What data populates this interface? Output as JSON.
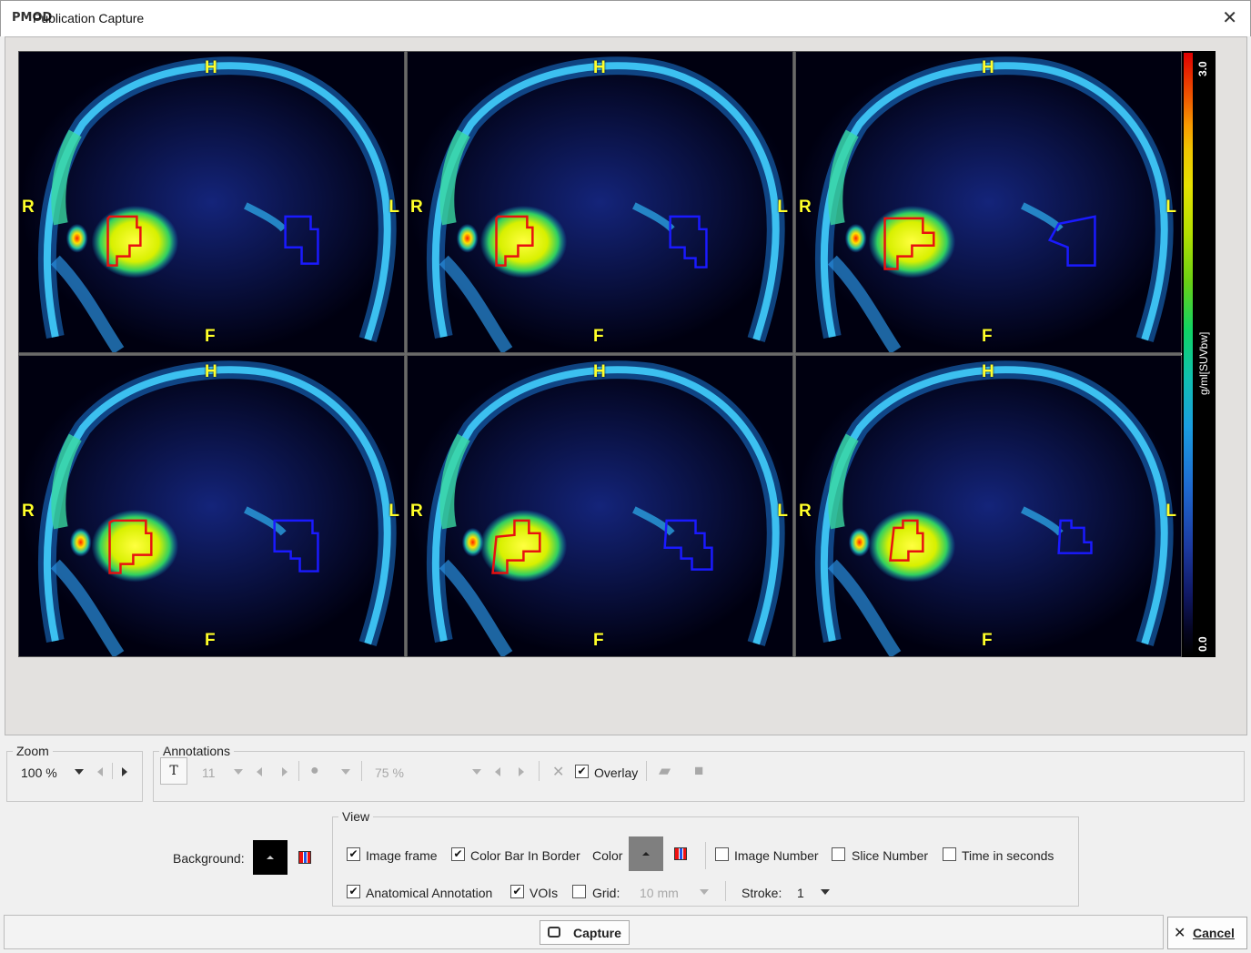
{
  "window": {
    "title": "Publication Capture",
    "app_icon": "PMOD",
    "close_glyph": "✕"
  },
  "viewer": {
    "cells": [
      {
        "top": "H",
        "bottom": "F",
        "left": "R",
        "right": "L"
      },
      {
        "top": "H",
        "bottom": "F",
        "left": "R",
        "right": "L"
      },
      {
        "top": "H",
        "bottom": "F",
        "left": "R",
        "right": "L"
      },
      {
        "top": "H",
        "bottom": "F",
        "left": "R",
        "right": "L"
      },
      {
        "top": "H",
        "bottom": "F",
        "left": "R",
        "right": "L"
      },
      {
        "top": "H",
        "bottom": "F",
        "left": "R",
        "right": "L"
      }
    ],
    "colorbar": {
      "max": "3.0",
      "min": "0.0",
      "unit": "g/ml[SUVbw]"
    }
  },
  "zoom": {
    "legend": "Zoom",
    "value": "100 %"
  },
  "annotations": {
    "legend": "Annotations",
    "text_tool": "T",
    "font_size": "11",
    "opacity": "75 %",
    "overlay_label": "Overlay",
    "overlay_checked": true
  },
  "background": {
    "label": "Background:",
    "color": "#000000"
  },
  "view": {
    "legend": "View",
    "image_frame": {
      "label": "Image frame",
      "checked": true
    },
    "color_bar_in_border": {
      "label": "Color Bar In Border",
      "checked": true
    },
    "color_label": "Color",
    "color_value": "#808080",
    "image_number": {
      "label": "Image Number",
      "checked": false
    },
    "slice_number": {
      "label": "Slice Number",
      "checked": false
    },
    "time_in_seconds": {
      "label": "Time in seconds",
      "checked": false
    },
    "anatomical_annotation": {
      "label": "Anatomical Annotation",
      "checked": true
    },
    "vois": {
      "label": "VOIs",
      "checked": true
    },
    "grid": {
      "label": "Grid:",
      "checked": false
    },
    "grid_size": "10 mm",
    "stroke_label": "Stroke:",
    "stroke_value": "1"
  },
  "actions": {
    "capture": "Capture",
    "cancel": "Cancel"
  }
}
